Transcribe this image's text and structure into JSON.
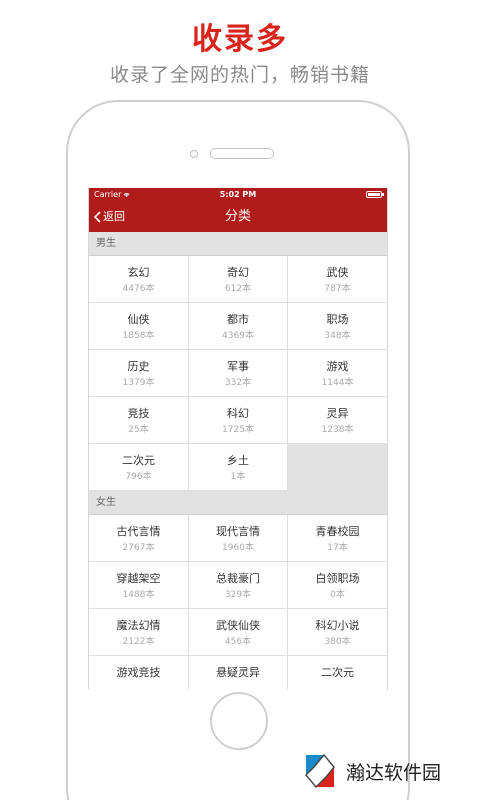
{
  "promo": {
    "headline": "收录多",
    "subline": "收录了全网的热门，畅销书籍"
  },
  "status_bar": {
    "carrier": "Carrier",
    "time": "5:02 PM"
  },
  "nav": {
    "back_label": "返回",
    "title": "分类"
  },
  "sections": [
    {
      "title": "男生",
      "items": [
        {
          "name": "玄幻",
          "count": "4476本"
        },
        {
          "name": "奇幻",
          "count": "612本"
        },
        {
          "name": "武侠",
          "count": "787本"
        },
        {
          "name": "仙侠",
          "count": "1858本"
        },
        {
          "name": "都市",
          "count": "4369本"
        },
        {
          "name": "职场",
          "count": "348本"
        },
        {
          "name": "历史",
          "count": "1379本"
        },
        {
          "name": "军事",
          "count": "332本"
        },
        {
          "name": "游戏",
          "count": "1144本"
        },
        {
          "name": "竞技",
          "count": "25本"
        },
        {
          "name": "科幻",
          "count": "1725本"
        },
        {
          "name": "灵异",
          "count": "1238本"
        },
        {
          "name": "二次元",
          "count": "796本"
        },
        {
          "name": "乡土",
          "count": "1本"
        }
      ]
    },
    {
      "title": "女生",
      "items": [
        {
          "name": "古代言情",
          "count": "2767本"
        },
        {
          "name": "现代言情",
          "count": "1960本"
        },
        {
          "name": "青春校园",
          "count": "17本"
        },
        {
          "name": "穿越架空",
          "count": "1488本"
        },
        {
          "name": "总裁豪门",
          "count": "329本"
        },
        {
          "name": "白领职场",
          "count": "0本"
        },
        {
          "name": "魔法幻情",
          "count": "2122本"
        },
        {
          "name": "武侠仙侠",
          "count": "456本"
        },
        {
          "name": "科幻小说",
          "count": "380本"
        },
        {
          "name": "游戏竞技",
          "count": ""
        },
        {
          "name": "悬疑灵异",
          "count": ""
        },
        {
          "name": "二次元",
          "count": ""
        }
      ]
    }
  ],
  "watermark": {
    "text": "瀚达软件园"
  },
  "colors": {
    "accent": "#b01c1c",
    "headline": "#d9241b"
  }
}
